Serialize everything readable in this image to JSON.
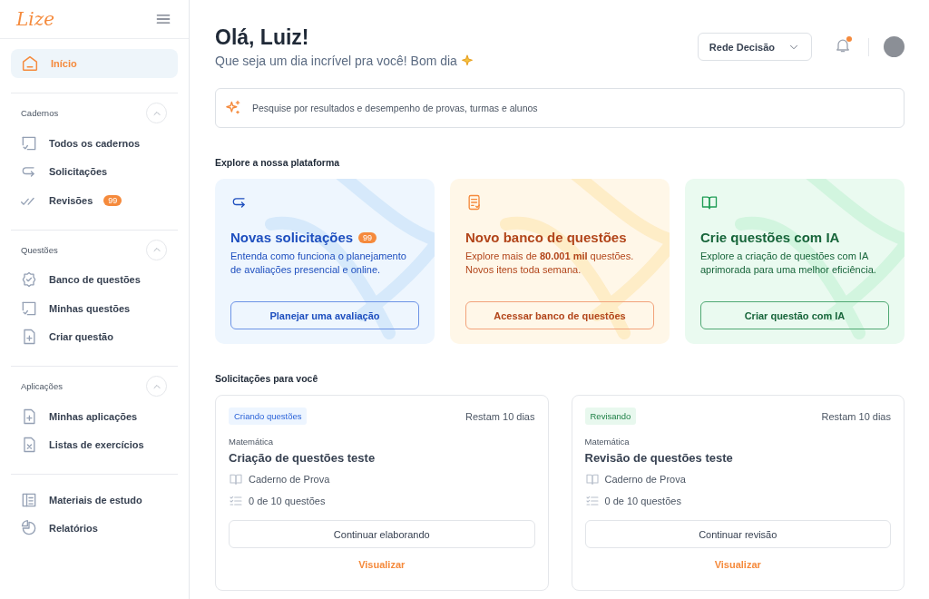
{
  "sidebar": {
    "logo": "Lize",
    "home": {
      "label": "Início",
      "selected": true
    },
    "sections": [
      {
        "title": "Cadernos",
        "expanded": true,
        "items": [
          {
            "label": "Todos os cadernos"
          },
          {
            "label": "Solicitações"
          },
          {
            "label": "Revisões",
            "badge": "99"
          }
        ]
      },
      {
        "title": "Questões",
        "expanded": true,
        "items": [
          {
            "label": "Banco de questões"
          },
          {
            "label": "Minhas questões"
          },
          {
            "label": "Criar questão"
          }
        ]
      },
      {
        "title": "Aplicações",
        "expanded": true,
        "items": [
          {
            "label": "Minhas aplicações"
          },
          {
            "label": "Listas de exercícios"
          }
        ]
      }
    ],
    "footer_items": [
      {
        "label": "Materiais de estudo"
      },
      {
        "label": "Relatórios"
      }
    ]
  },
  "header": {
    "greeting": "Olá, Luiz!",
    "subtitle": "Que seja um dia incrível pra você! Bom dia",
    "network": "Rede Decisão",
    "has_notification": true
  },
  "search": {
    "placeholder": "Pesquise por resultados e desempenho de provas, turmas e alunos"
  },
  "explore": {
    "title": "Explore a nossa plataforma",
    "cards": [
      {
        "kind": "blue",
        "title": "Novas solicitações",
        "badge": "99",
        "description": "Entenda como funciona o planejamento de avaliações presencial e online.",
        "button": "Planejar uma avaliação"
      },
      {
        "kind": "orange",
        "title": "Novo banco de questões",
        "description": "Explore mais de **80.001 mil** questões. Novos itens toda semana.",
        "button": "Acessar banco de questões"
      },
      {
        "kind": "green",
        "title": "Crie questões com IA",
        "description": "Explore a criação de questões com IA aprimorada para uma melhor eficiência.",
        "button": "Criar questão com IA"
      }
    ]
  },
  "requests": {
    "title": "Solicitações para você",
    "cards": [
      {
        "status": {
          "kind": "creating",
          "label": "Criando questões"
        },
        "remaining": "Restam 10 dias",
        "subject": "Matemática",
        "title": "Criação de questões teste",
        "notebook": "Caderno de Prova",
        "progress": "0 de 10 questões",
        "button": "Continuar elaborando",
        "link": "Visualizar"
      },
      {
        "status": {
          "kind": "reviewing",
          "label": "Revisando"
        },
        "remaining": "Restam 10 dias",
        "subject": "Matemática",
        "title": "Revisão de questões teste",
        "notebook": "Caderno de Prova",
        "progress": "0 de 10 questões",
        "button": "Continuar revisão",
        "link": "Visualizar"
      }
    ]
  }
}
